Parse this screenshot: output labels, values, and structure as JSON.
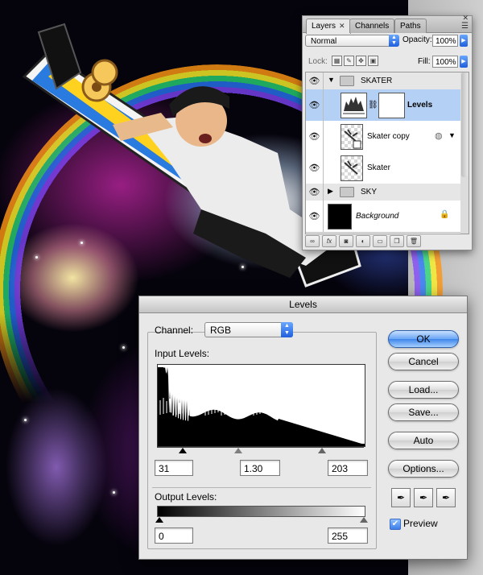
{
  "layers_panel": {
    "tabs": [
      {
        "label": "Layers",
        "active": true
      },
      {
        "label": "Channels",
        "active": false
      },
      {
        "label": "Paths",
        "active": false
      }
    ],
    "blend_mode": "Normal",
    "opacity_label": "Opacity:",
    "opacity_value": "100%",
    "lock_label": "Lock:",
    "fill_label": "Fill:",
    "fill_value": "100%",
    "layers": [
      {
        "name": "SKATER",
        "type": "group",
        "expanded": true,
        "visible": true
      },
      {
        "name": "Levels",
        "type": "adjustment",
        "selected": true,
        "visible": true
      },
      {
        "name": "Skater copy",
        "type": "smart-object",
        "visible": true
      },
      {
        "name": "Skater",
        "type": "layer",
        "visible": true
      },
      {
        "name": "SKY",
        "type": "group",
        "expanded": false,
        "visible": true
      },
      {
        "name": "Background",
        "type": "background",
        "locked": true,
        "visible": true
      }
    ]
  },
  "levels_dialog": {
    "title": "Levels",
    "channel_label": "Channel:",
    "channel_value": "RGB",
    "input_levels_label": "Input Levels:",
    "input_black": "31",
    "input_gamma": "1.30",
    "input_white": "203",
    "output_levels_label": "Output Levels:",
    "output_black": "0",
    "output_white": "255",
    "buttons": {
      "ok": "OK",
      "cancel": "Cancel",
      "load": "Load...",
      "save": "Save...",
      "auto": "Auto",
      "options": "Options..."
    },
    "preview_label": "Preview",
    "preview_checked": true
  },
  "colors": {
    "selection_blue": "#b5d0f5",
    "button_default_blue": "#3f86ea",
    "panel_gray": "#e8e8e8"
  }
}
